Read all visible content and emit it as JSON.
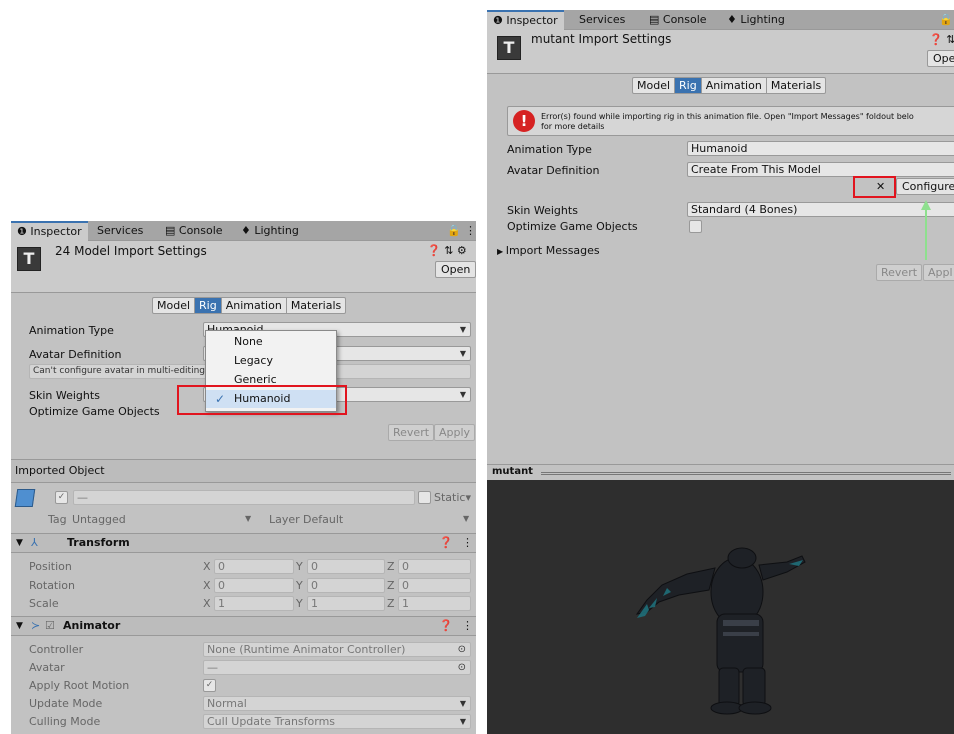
{
  "left_panel": {
    "tabs": [
      "Inspector",
      "Services",
      "Console",
      "Lighting"
    ],
    "title": "24 Model Import Settings",
    "open_label": "Open",
    "rig_tabs": [
      "Model",
      "Rig",
      "Animation",
      "Materials"
    ],
    "active_rig_tab": "Rig",
    "animation_type_label": "Animation Type",
    "animation_type_value": "Humanoid",
    "avatar_definition_label": "Avatar Definition",
    "avatar_note": "Can't configure avatar in multi-editing m",
    "skin_weights_label": "Skin Weights",
    "optimize_label": "Optimize Game Objects",
    "revert_label": "Revert",
    "apply_label": "Apply",
    "dropdown_options": [
      "None",
      "Legacy",
      "Generic",
      "Humanoid"
    ],
    "dropdown_selected": "Humanoid",
    "imported_object_label": "Imported Object",
    "name_value": "—",
    "static_label": "Static",
    "tag_label": "Tag",
    "tag_value": "Untagged",
    "layer_label": "Layer",
    "layer_value": "Default",
    "transform_label": "Transform",
    "position_label": "Position",
    "rotation_label": "Rotation",
    "scale_label": "Scale",
    "axis_x": "X",
    "axis_y": "Y",
    "axis_z": "Z",
    "position": [
      "0",
      "0",
      "0"
    ],
    "rotation": [
      "0",
      "0",
      "0"
    ],
    "scale": [
      "1",
      "1",
      "1"
    ],
    "animator_label": "Animator",
    "controller_label": "Controller",
    "controller_value": "None (Runtime Animator Controller)",
    "avatar_label": "Avatar",
    "avatar_value": "—",
    "apply_root_motion_label": "Apply Root Motion",
    "update_mode_label": "Update Mode",
    "update_mode_value": "Normal",
    "culling_mode_label": "Culling Mode",
    "culling_mode_value": "Cull Update Transforms"
  },
  "right_panel": {
    "tabs": [
      "Inspector",
      "Services",
      "Console",
      "Lighting"
    ],
    "title": "mutant Import Settings",
    "open_label": "Ope",
    "rig_tabs": [
      "Model",
      "Rig",
      "Animation",
      "Materials"
    ],
    "active_rig_tab": "Rig",
    "error_line1": "Error(s) found while importing rig in this animation file. Open \"Import Messages\" foldout belo",
    "error_line2": "for more details",
    "animation_type_label": "Animation Type",
    "animation_type_value": "Humanoid",
    "avatar_definition_label": "Avatar Definition",
    "avatar_definition_value": "Create From This Model",
    "x_button": "✕",
    "configure_label": "Configure.",
    "skin_weights_label": "Skin Weights",
    "skin_weights_value": "Standard (4 Bones)",
    "optimize_label": "Optimize Game Objects",
    "import_messages_label": "Import Messages",
    "revert_label": "Revert",
    "apply_label": "Appl",
    "preview_label": "mutant"
  },
  "colors": {
    "accent": "#3a72b0",
    "highlight_box": "#e1141e",
    "arrow": "#8ee08e"
  }
}
